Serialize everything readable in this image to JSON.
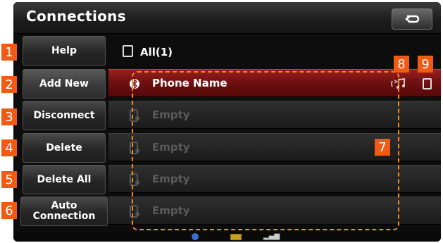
{
  "header": {
    "title": "Connections"
  },
  "left_buttons": [
    {
      "label": "Help"
    },
    {
      "label": "Add New"
    },
    {
      "label": "Disconnect"
    },
    {
      "label": "Delete"
    },
    {
      "label": "Delete All"
    },
    {
      "label": "Auto Connection"
    }
  ],
  "list": {
    "all_label": "All(1)",
    "rows": [
      {
        "label": "Phone Name",
        "icon": "bluetooth-icon"
      },
      {
        "label": "Empty",
        "icon": "phone-icon"
      },
      {
        "label": "Empty",
        "icon": "phone-icon"
      },
      {
        "label": "Empty",
        "icon": "phone-icon"
      },
      {
        "label": "Empty",
        "icon": "phone-icon"
      }
    ]
  },
  "callouts": [
    "1",
    "2",
    "3",
    "4",
    "5",
    "6",
    "7",
    "8",
    "9"
  ],
  "colors": {
    "accent": "#f05a14",
    "selected_row": "#8a1a1a",
    "dashed_outline": "#f08a1e"
  }
}
